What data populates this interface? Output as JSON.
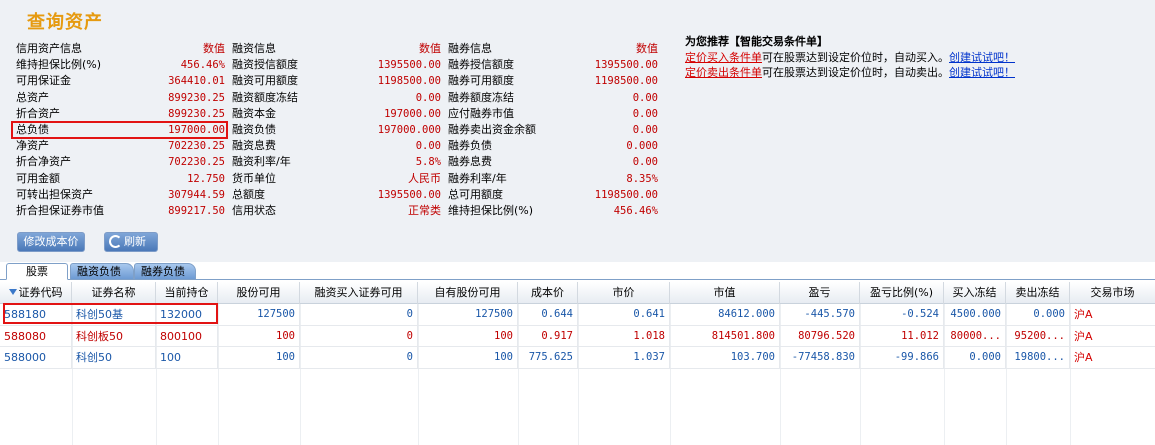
{
  "title": "查询资产",
  "credit": {
    "header": {
      "label": "信用资产信息",
      "value": "数值"
    },
    "rows": [
      {
        "label": "维持担保比例(%)",
        "value": "456.46%"
      },
      {
        "label": "可用保证金",
        "value": "364410.01"
      },
      {
        "label": "总资产",
        "value": "899230.25"
      },
      {
        "label": "折合资产",
        "value": "899230.25"
      },
      {
        "label": "总负债",
        "value": "197000.00"
      },
      {
        "label": "净资产",
        "value": "702230.25"
      },
      {
        "label": "折合净资产",
        "value": "702230.25"
      },
      {
        "label": "可用金额",
        "value": "12.750"
      },
      {
        "label": "可转出担保资产",
        "value": "307944.59"
      },
      {
        "label": "折合担保证券市值",
        "value": "899217.50"
      }
    ]
  },
  "financing": {
    "header": {
      "label": "融资信息",
      "value": "数值"
    },
    "rows": [
      {
        "label": "融资授信额度",
        "value": "1395500.00"
      },
      {
        "label": "融资可用额度",
        "value": "1198500.00"
      },
      {
        "label": "融资额度冻结",
        "value": "0.00"
      },
      {
        "label": "融资本金",
        "value": "197000.00"
      },
      {
        "label": "融资负债",
        "value": "197000.000"
      },
      {
        "label": "融资息费",
        "value": "0.00"
      },
      {
        "label": "融资利率/年",
        "value": "5.8%"
      },
      {
        "label": "货币单位",
        "value": "人民币"
      },
      {
        "label": "总额度",
        "value": "1395500.00"
      },
      {
        "label": "信用状态",
        "value": "正常类"
      }
    ]
  },
  "securities": {
    "header": {
      "label": "融券信息",
      "value": "数值"
    },
    "rows": [
      {
        "label": "融券授信额度",
        "value": "1395500.00"
      },
      {
        "label": "融券可用额度",
        "value": "1198500.00"
      },
      {
        "label": "融券额度冻结",
        "value": "0.00"
      },
      {
        "label": "应付融券市值",
        "value": "0.00"
      },
      {
        "label": "融券卖出资金余额",
        "value": "0.00"
      },
      {
        "label": "融券负债",
        "value": "0.000"
      },
      {
        "label": "融券息费",
        "value": "0.00"
      },
      {
        "label": "融券利率/年",
        "value": "8.35%"
      },
      {
        "label": "总可用额度",
        "value": "1198500.00"
      },
      {
        "label": "维持担保比例(%)",
        "value": "456.46%"
      }
    ]
  },
  "recommend": {
    "head": "为您推荐【智能交易条件单】",
    "buy_link": "定价买入条件单",
    "buy_text": "可在股票达到设定价位时，自动买入。",
    "sell_link": "定价卖出条件单",
    "sell_text": "可在股票达到设定价位时，自动卖出。",
    "try_link": "创建试试吧！"
  },
  "buttons": {
    "modify_cost": "修改成本价",
    "refresh": "刷新"
  },
  "tabs": [
    "股票",
    "融资负债",
    "融券负债"
  ],
  "table": {
    "columns": [
      "证券代码",
      "证券名称",
      "当前持仓",
      "股份可用",
      "融资买入证券可用",
      "自有股份可用",
      "成本价",
      "市价",
      "市值",
      "盈亏",
      "盈亏比例(%)",
      "买入冻结",
      "卖出冻结",
      "交易市场"
    ],
    "rows": [
      [
        "588180",
        "科创50基",
        "132000",
        "127500",
        "0",
        "127500",
        "0.644",
        "0.641",
        "84612.000",
        "-445.570",
        "-0.524",
        "4500.000",
        "0.000",
        "沪A"
      ],
      [
        "588080",
        "科创板50",
        "800100",
        "100",
        "0",
        "100",
        "0.917",
        "1.018",
        "814501.800",
        "80796.520",
        "11.012",
        "80000...",
        "95200...",
        "沪A"
      ],
      [
        "588000",
        "科创50",
        "100",
        "100",
        "0",
        "100",
        "775.625",
        "1.037",
        "103.700",
        "-77458.830",
        "-99.866",
        "0.000",
        "19800...",
        "沪A"
      ]
    ]
  },
  "colors": {
    "title": "#e69a10",
    "value_red": "#c00000",
    "highlight_box": "#e21313",
    "button_blue": "#4a78b8"
  }
}
